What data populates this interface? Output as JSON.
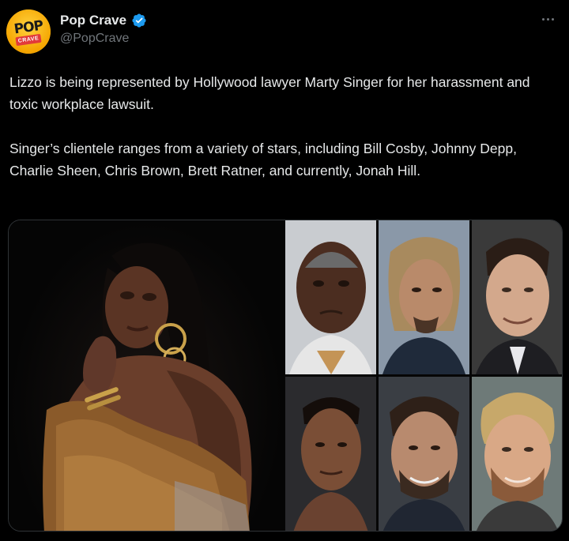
{
  "account": {
    "display_name": "Pop Crave",
    "handle": "@PopCrave",
    "avatar_text_top": "POP",
    "avatar_text_bottom": "CRAVE",
    "verified_color": "#1d9bf0"
  },
  "tweet": {
    "paragraphs": [
      "Lizzo is being represented by Hollywood lawyer Marty Singer for her harassment and toxic workplace lawsuit.",
      "Singer’s clientele ranges from a variety of stars, including Bill Cosby, Johnny Depp, Charlie Sheen, Chris Brown, Brett Ratner, and currently, Jonah Hill."
    ]
  },
  "icons": {
    "verified": "verified-badge-icon",
    "more": "more-options-icon"
  },
  "colors": {
    "background": "#000000",
    "text": "#e7e9ea",
    "secondary_text": "#71767b",
    "brand_yellow": "#f5a500"
  }
}
